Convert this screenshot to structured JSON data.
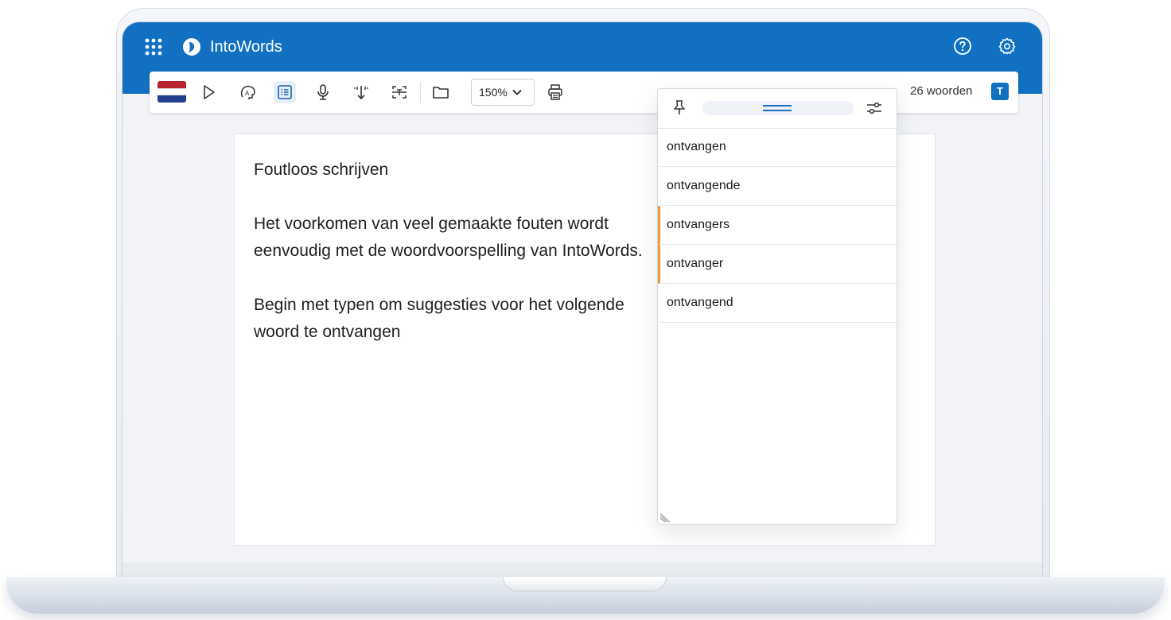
{
  "app": {
    "title": "IntoWords"
  },
  "toolbar": {
    "flag_label": "Nederlands",
    "zoom": "150%",
    "word_count": "26 woorden",
    "badge": "T"
  },
  "document": {
    "heading": "Foutloos schrijven",
    "paragraph1": "Het voorkomen van veel gemaakte fouten wordt eenvoudig met de woordvoorspelling van IntoWords.",
    "paragraph2": "Begin met typen om suggesties voor het volgende woord te ontvangen"
  },
  "predictions": {
    "items": [
      "ontvangen",
      "ontvangende",
      "ontvangers",
      "ontvanger",
      "ontvangend"
    ]
  },
  "colors": {
    "header": "#1270c2",
    "accent_marker": "#ee9b3a"
  },
  "icons": [
    "apps-grid-icon",
    "intowords-logo-icon",
    "help-icon",
    "gear-icon",
    "play-icon",
    "read-aloud-icon",
    "word-prediction-icon",
    "microphone-icon",
    "touch-icon",
    "scan-text-icon",
    "folder-icon",
    "chevron-down-icon",
    "print-icon",
    "pin-icon",
    "filter-settings-icon"
  ]
}
